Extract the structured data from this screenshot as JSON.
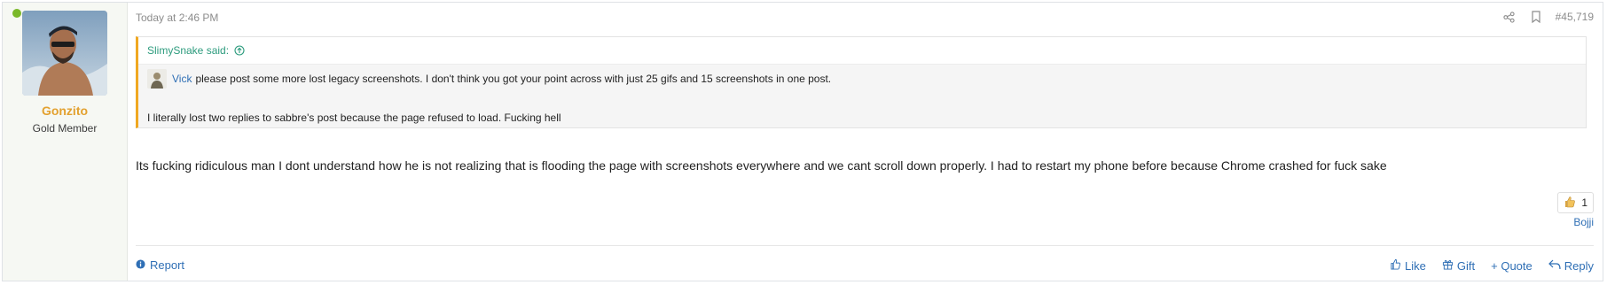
{
  "user": {
    "name": "Gonzito",
    "title": "Gold Member",
    "online": true
  },
  "post": {
    "date": "Today at 2:46 PM",
    "number": "#45,719"
  },
  "quote": {
    "author_label": "SlimySnake said:",
    "mention": "Vick",
    "line1": "please post some more lost legacy screenshots. I don't think you got your point across with just 25 gifs and 15 screenshots in one post.",
    "line2": "I literally lost two replies to sabbre's post because the page refused to load. Fucking hell"
  },
  "message": "Its fucking ridiculous man I dont understand how he is not realizing that is flooding the page with screenshots everywhere and we cant scroll down properly. I had to restart my phone before because Chrome crashed for fuck sake",
  "reactions": {
    "count": "1",
    "reactor": "Bojji"
  },
  "footer": {
    "report": "Report",
    "like": "Like",
    "gift": "Gift",
    "quote": "+ Quote",
    "reply": "Reply"
  },
  "colors": {
    "username": "#e3a12f",
    "quote_border": "#f0a821",
    "quote_author": "#2c9b7d",
    "link": "#2f6fb5",
    "online": "#7ab829"
  }
}
